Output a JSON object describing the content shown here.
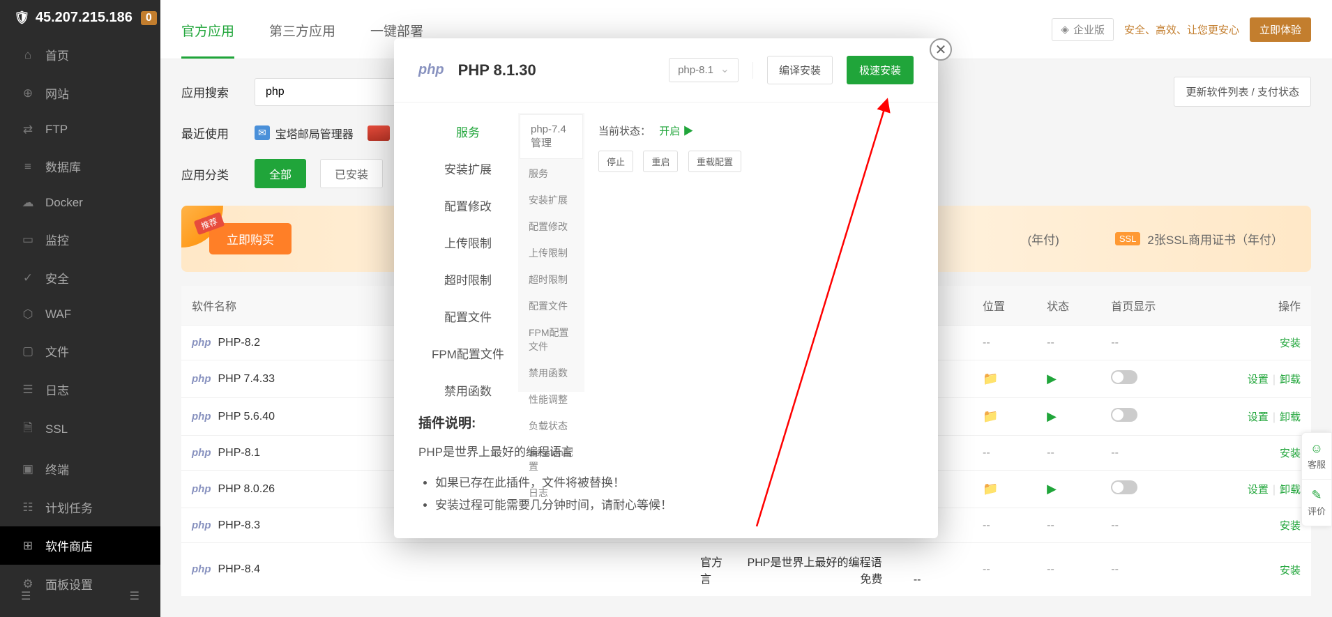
{
  "sidebar": {
    "ip": "45.207.215.186",
    "badge": "0",
    "items": [
      {
        "label": "首页",
        "icon": "⌂"
      },
      {
        "label": "网站",
        "icon": "⊕"
      },
      {
        "label": "FTP",
        "icon": "⇄"
      },
      {
        "label": "数据库",
        "icon": "≡"
      },
      {
        "label": "Docker",
        "icon": "☁"
      },
      {
        "label": "监控",
        "icon": "▭"
      },
      {
        "label": "安全",
        "icon": "✓"
      },
      {
        "label": "WAF",
        "icon": "⬡"
      },
      {
        "label": "文件",
        "icon": "▢"
      },
      {
        "label": "日志",
        "icon": "☰"
      },
      {
        "label": "SSL",
        "icon": "🗎"
      },
      {
        "label": "终端",
        "icon": "▣"
      },
      {
        "label": "计划任务",
        "icon": "☷"
      },
      {
        "label": "软件商店",
        "icon": "⊞"
      },
      {
        "label": "面板设置",
        "icon": "⚙"
      }
    ]
  },
  "topbar": {
    "tabs": [
      "官方应用",
      "第三方应用",
      "一键部署"
    ],
    "enterprise": "企业版",
    "promo": "安全、高效、让您更安心",
    "trial_btn": "立即体验"
  },
  "search": {
    "label": "应用搜索",
    "value": "php",
    "update_btn": "更新软件列表 / 支付状态"
  },
  "recent": {
    "label": "最近使用",
    "mail_icon_text": "✉",
    "item1": "宝塔邮局管理器"
  },
  "category": {
    "label": "应用分类",
    "all": "全部",
    "installed": "已安装"
  },
  "banner": {
    "recommend": "推荐",
    "buy_btn": "立即购买",
    "item1": "(年付)",
    "ssl_text": "2张SSL商用证书（年付）"
  },
  "table": {
    "headers": [
      "软件名称",
      "位置",
      "状态",
      "首页显示",
      "操作"
    ],
    "col_source": "官方",
    "col_desc": "PHP是世界上最好的编程语言",
    "col_price": "免费",
    "rows": [
      {
        "name": "PHP-8.2",
        "installed": false
      },
      {
        "name": "PHP 7.4.33",
        "installed": true
      },
      {
        "name": "PHP 5.6.40",
        "installed": true
      },
      {
        "name": "PHP-8.1",
        "installed": false
      },
      {
        "name": "PHP 8.0.26",
        "installed": true
      },
      {
        "name": "PHP-8.3",
        "installed": false
      },
      {
        "name": "PHP-8.4",
        "installed": false
      }
    ],
    "action_install": "安装",
    "action_settings": "设置",
    "action_uninstall": "卸载",
    "dash": "--"
  },
  "modal": {
    "logo": "php",
    "title": "PHP 8.1.30",
    "select": "php-8.1",
    "compile_btn": "编译安装",
    "fast_btn": "极速安装",
    "left_items": [
      "服务",
      "安装扩展",
      "配置修改",
      "上传限制",
      "超时限制",
      "配置文件",
      "FPM配置文件",
      "禁用函数"
    ],
    "mid_title": "php-7.4管理",
    "mid_items": [
      "服务",
      "安装扩展",
      "配置修改",
      "上传限制",
      "超时限制",
      "配置文件",
      "FPM配置文件",
      "禁用函数",
      "性能调整",
      "负载状态",
      "Session配置",
      "日志"
    ],
    "status_label": "当前状态：",
    "status_value": "开启",
    "mini_btns": [
      "停止",
      "重启",
      "重载配置"
    ],
    "plugin_title": "插件说明:",
    "plugin_desc": "PHP是世界上最好的编程语言",
    "plugin_notes": [
      "如果已存在此插件，文件将被替换！",
      "安装过程可能需要几分钟时间，请耐心等候！"
    ]
  },
  "float": {
    "service": "客服",
    "feedback": "评价"
  }
}
